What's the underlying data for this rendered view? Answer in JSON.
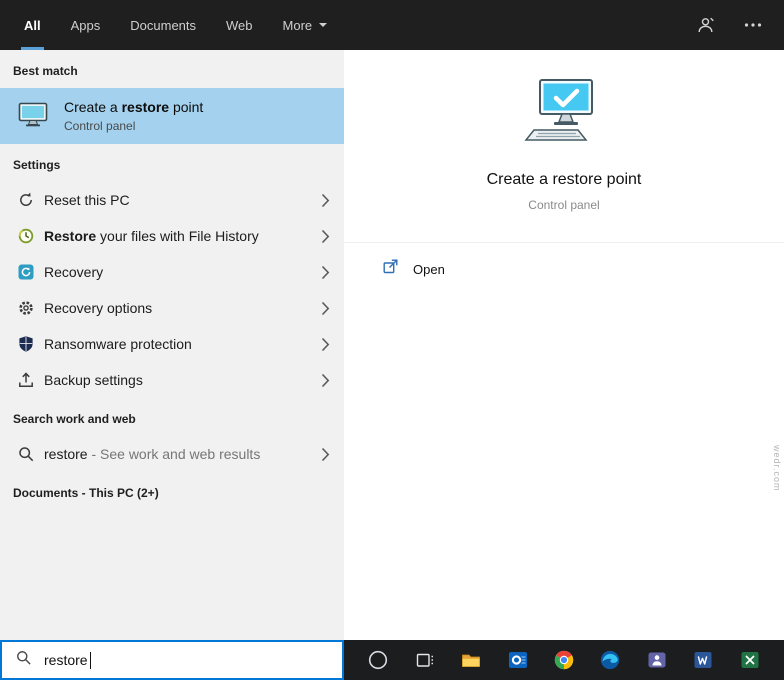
{
  "topbar": {
    "tabs": [
      {
        "label": "All"
      },
      {
        "label": "Apps"
      },
      {
        "label": "Documents"
      },
      {
        "label": "Web"
      },
      {
        "label": "More"
      }
    ]
  },
  "left_panel": {
    "best_match_header": "Best match",
    "best_match": {
      "title_pre": "Create a ",
      "title_match": "restore",
      "title_post": " point",
      "subtitle": "Control panel"
    },
    "settings_header": "Settings",
    "items": [
      {
        "bold": "",
        "label": "Reset this PC"
      },
      {
        "bold": "Restore",
        "label": " your files with File History"
      },
      {
        "bold": "",
        "label": "Recovery"
      },
      {
        "bold": "",
        "label": "Recovery options"
      },
      {
        "bold": "",
        "label": "Ransomware protection"
      },
      {
        "bold": "",
        "label": "Backup settings"
      }
    ],
    "search_header": "Search work and web",
    "web_item": {
      "query": "restore",
      "hint": " - See work and web results"
    },
    "documents_header": "Documents - This PC (2+)"
  },
  "right_panel": {
    "title": "Create a restore point",
    "subtitle": "Control panel",
    "open_label": "Open"
  },
  "search_box": {
    "value": "restore"
  },
  "taskbar": {
    "icons": [
      "cortana-icon",
      "task-view-icon",
      "file-explorer-icon",
      "outlook-icon",
      "chrome-icon",
      "edge-icon",
      "teams-icon",
      "word-icon",
      "excel-icon"
    ]
  },
  "watermark": "wedr.com",
  "colors": {
    "accent": "#0078d7",
    "highlight": "#a3d1ee",
    "tab_underline": "#5ba0d7",
    "topbar_bg": "#1f1f1f",
    "panel_bg": "#f1f1f1"
  }
}
